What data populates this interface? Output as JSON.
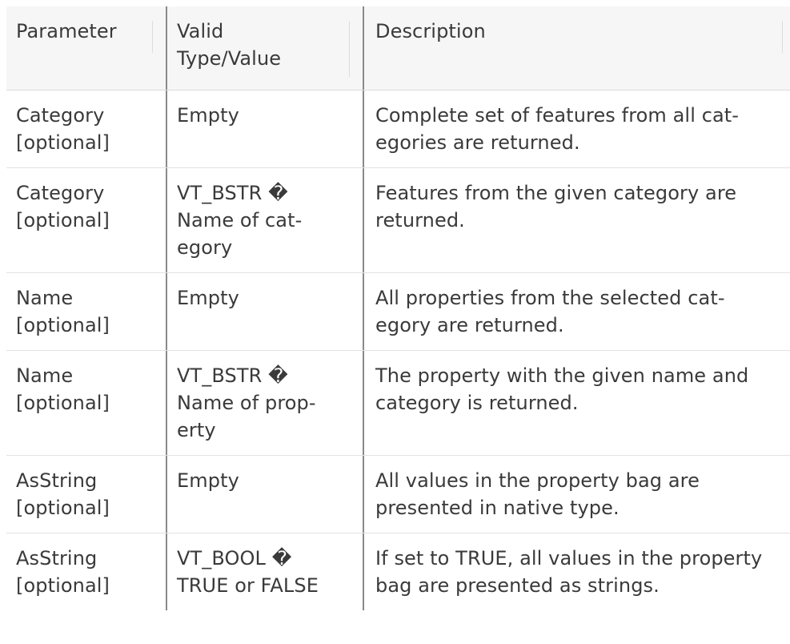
{
  "header": {
    "parameter": "Parameter",
    "valid_type_lines": [
      "Valid",
      "Type/Value"
    ],
    "description": "Description"
  },
  "rows": [
    {
      "parameter": [
        "Category",
        "[optional]"
      ],
      "valid": [
        "Empty"
      ],
      "description": [
        "Complete set of features from all cat-",
        "egories are returned."
      ]
    },
    {
      "parameter": [
        "Category",
        "[optional]"
      ],
      "valid": [
        "VT_BSTR �",
        "Name of cat-",
        "egory"
      ],
      "description": [
        "Features from the given category are",
        "returned."
      ]
    },
    {
      "parameter": [
        "Name",
        "[optional]"
      ],
      "valid": [
        "Empty"
      ],
      "description": [
        "All properties from the selected cat-",
        "egory are returned."
      ]
    },
    {
      "parameter": [
        "Name",
        "[optional]"
      ],
      "valid": [
        "VT_BSTR �",
        "Name of prop-",
        "erty"
      ],
      "description": [
        "The property with the given name and",
        "category is returned."
      ]
    },
    {
      "parameter": [
        "AsString",
        "[optional]"
      ],
      "valid": [
        "Empty"
      ],
      "description": [
        "All values in the property bag are",
        "presented in native type."
      ]
    },
    {
      "parameter": [
        "AsString",
        "[optional]"
      ],
      "valid": [
        "VT_BOOL �",
        "TRUE or FALSE"
      ],
      "description": [
        "If set to TRUE, all values in the property",
        "bag are presented as strings."
      ]
    }
  ]
}
